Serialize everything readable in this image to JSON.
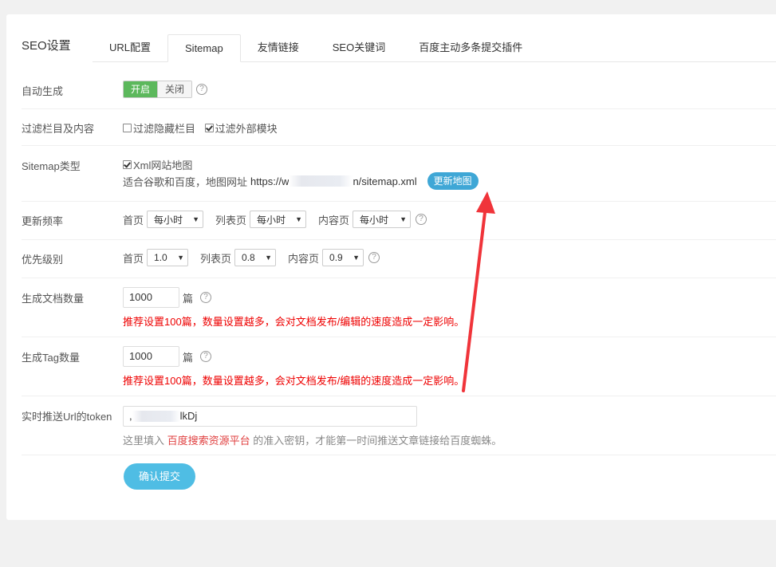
{
  "page_title": "SEO设置",
  "tabs": [
    {
      "label": "URL配置"
    },
    {
      "label": "Sitemap"
    },
    {
      "label": "友情链接"
    },
    {
      "label": "SEO关键词"
    },
    {
      "label": "百度主动多条提交插件"
    }
  ],
  "auto_generate": {
    "label": "自动生成",
    "on": "开启",
    "off": "关闭"
  },
  "filter": {
    "label": "过滤栏目及内容",
    "opt_hidden": "过滤隐藏栏目",
    "opt_external": "过滤外部模块"
  },
  "sitemap_type": {
    "label": "Sitemap类型",
    "xml": "Xml网站地图",
    "desc": "适合谷歌和百度，地图网址",
    "url_start": "https://w",
    "url_end": "n/sitemap.xml",
    "update_button": "更新地图"
  },
  "frequency": {
    "label": "更新频率",
    "home": "首页",
    "home_value": "每小时",
    "list": "列表页",
    "list_value": "每小时",
    "content": "内容页",
    "content_value": "每小时"
  },
  "priority": {
    "label": "优先级别",
    "home": "首页",
    "home_value": "1.0",
    "list": "列表页",
    "list_value": "0.8",
    "content": "内容页",
    "content_value": "0.9"
  },
  "doc_count": {
    "label": "生成文档数量",
    "value": "1000",
    "unit": "篇",
    "warning": "推荐设置100篇，数量设置越多，会对文档发布/编辑的速度造成一定影响。"
  },
  "tag_count": {
    "label": "生成Tag数量",
    "value": "1000",
    "unit": "篇",
    "warning": "推荐设置100篇，数量设置越多，会对文档发布/编辑的速度造成一定影响。"
  },
  "token": {
    "label": "实时推送Url的token",
    "value_start": ",",
    "value_end": "lkDj",
    "hint_prefix": "这里填入",
    "hint_link": "百度搜索资源平台",
    "hint_suffix": "的准入密钥，才能第一时间推送文章链接给百度蜘蛛。"
  },
  "submit_label": "确认提交",
  "colors": {
    "accent": "#4fbde4",
    "toggle_on": "#5cb85c",
    "warning": "#ee0000",
    "arrow": "#f0343a"
  }
}
